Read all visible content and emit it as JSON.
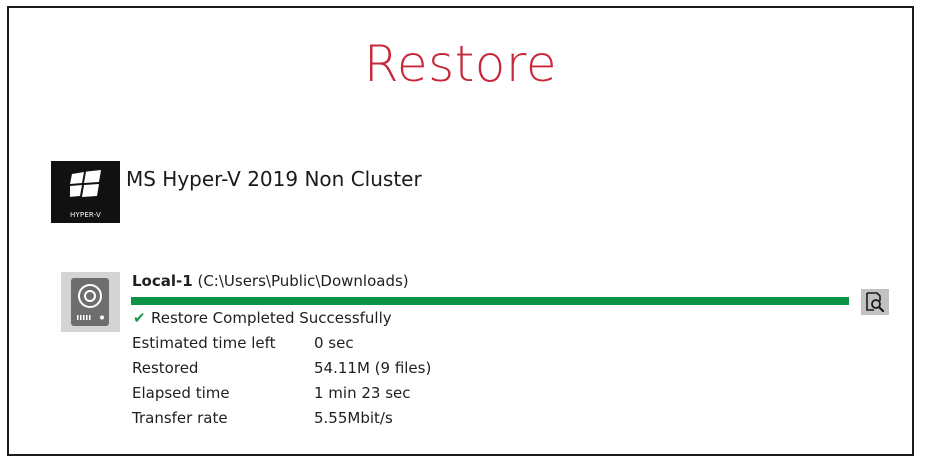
{
  "page": {
    "title": "Restore"
  },
  "backup_set": {
    "name": "MS Hyper-V 2019 Non Cluster",
    "icon_name": "hyper-v-icon",
    "icon_caption": "HYPER-V"
  },
  "destination": {
    "icon_name": "hard-drive-icon",
    "name": "Local-1",
    "path": "(C:\\Users\\Public\\Downloads)",
    "progress_percent": 100,
    "status_icon": "check-icon",
    "status_text": "Restore Completed Successfully",
    "view_log_icon": "view-log-icon",
    "stats": [
      {
        "label": "Estimated time left",
        "value": "0 sec"
      },
      {
        "label": "Restored",
        "value": "54.11M (9 files)"
      },
      {
        "label": "Elapsed time",
        "value": "1 min 23 sec"
      },
      {
        "label": "Transfer rate",
        "value": "5.55Mbit/s"
      }
    ]
  },
  "colors": {
    "title": "#c8283b",
    "progress": "#0a9347",
    "success_check": "#1a9a47",
    "frame_border": "#1c1c1c"
  }
}
